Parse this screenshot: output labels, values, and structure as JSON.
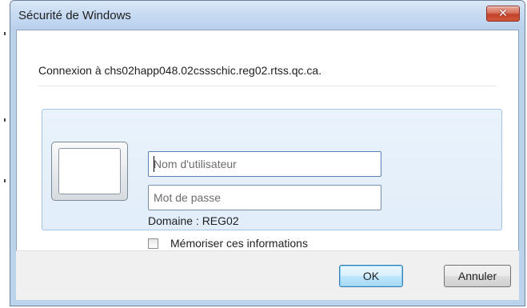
{
  "window": {
    "title": "Sécurité de Windows",
    "close_icon": "close-icon"
  },
  "message": {
    "connection": "Connexion à chs02happ048.02cssschic.reg02.rtss.qc.ca."
  },
  "credentials": {
    "username_placeholder": "Nom d'utilisateur",
    "username_value": "",
    "password_placeholder": "Mot de passe",
    "password_value": "",
    "domain_text": "Domaine : REG02",
    "remember_label": "Mémoriser ces informations",
    "remember_checked": false,
    "user_tile_icon": "user-tile-icon"
  },
  "buttons": {
    "ok_label": "OK",
    "cancel_label": "Annuler"
  },
  "colors": {
    "accent": "#3c7fb1",
    "close_button": "#c2412a",
    "panel_background": "#e1edf9"
  }
}
